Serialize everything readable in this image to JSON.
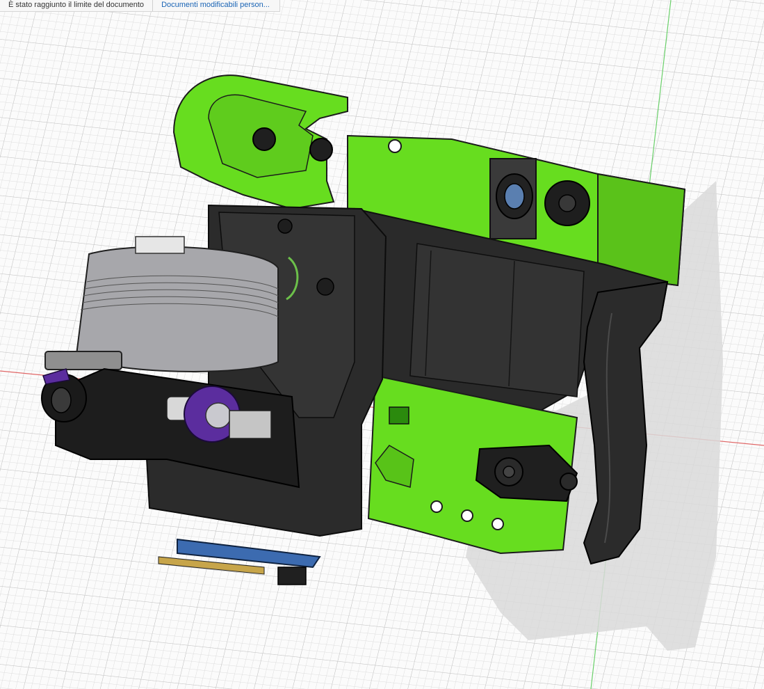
{
  "notice": {
    "message": "È stato raggiunto il limite del documento",
    "link_label": "Documenti modificabili person..."
  },
  "viewport": {
    "model": "extruder-toolhead-assembly",
    "colors": {
      "grid_background": "#fbfbfb",
      "grid_minor": "#dcdcdc",
      "grid_major": "#c7c7c7",
      "axis_x": "#e06666",
      "axis_y": "#6ad06a",
      "part_green": "#67dd1f",
      "part_dark": "#1f1f1f",
      "part_grey": "#a7a7ab",
      "accent_purple": "#5b2d9e",
      "pcb_blue": "#3c6bb0",
      "shadow": "#dedede"
    }
  }
}
